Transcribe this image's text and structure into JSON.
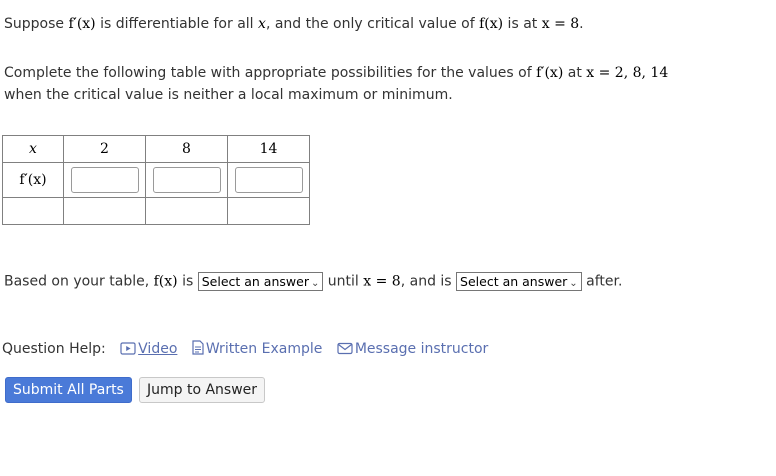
{
  "problem": {
    "s1_a": "Suppose ",
    "s1_fp": "f′(x)",
    "s1_b": " is differentiable for all ",
    "s1_x": "x",
    "s1_c": ", and the only critical value of ",
    "s1_fx": "f(x)",
    "s1_d": " is at ",
    "s1_eq": "x = 8",
    "s1_e": ".",
    "s2_a": "Complete the following table with appropriate possibilities for the values of ",
    "s2_fp": "f′(x)",
    "s2_b": " at ",
    "s2_eq": "x = 2, 8, 14",
    "s2_c": "when the critical value is neither a local maximum or minimum."
  },
  "table": {
    "header_label": "x",
    "row_label": "f′(x)",
    "columns": [
      "2",
      "8",
      "14"
    ],
    "inputs": [
      "",
      "",
      ""
    ]
  },
  "answer": {
    "a": "Based on your table, ",
    "fx": "f(x)",
    "b": " is ",
    "select1": "Select an answer",
    "c": " until ",
    "eq": "x = 8",
    "d": ", and is ",
    "select2": "Select an answer",
    "e": " after."
  },
  "help": {
    "label": "Question Help:",
    "video": "Video",
    "written": "Written Example",
    "message": "Message instructor"
  },
  "buttons": {
    "submit": "Submit All Parts",
    "jump": "Jump to Answer"
  },
  "colors": {
    "link": "#5a6fb0",
    "primary_button": "#4a7ad8"
  }
}
